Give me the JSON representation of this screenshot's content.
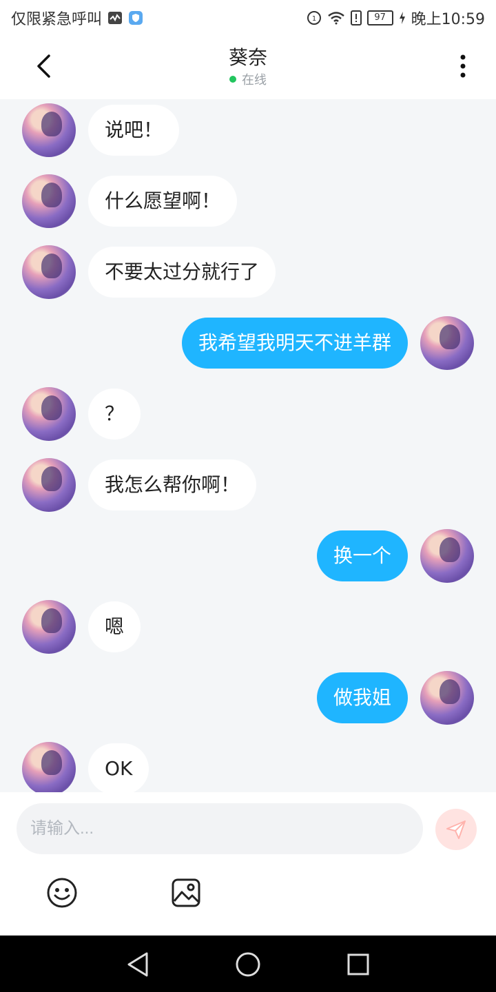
{
  "statusbar": {
    "left_text": "仅限紧急呼叫",
    "battery_level": "97",
    "time": "晚上10:59",
    "icons": [
      "activity-icon",
      "shield-icon",
      "hd-icon",
      "wifi-icon",
      "alert-icon",
      "charging-icon"
    ]
  },
  "header": {
    "title": "葵奈",
    "status": "在线",
    "status_color": "#22c55e"
  },
  "messages": [
    {
      "side": "left",
      "text": "说吧！"
    },
    {
      "side": "left",
      "text": "什么愿望啊！"
    },
    {
      "side": "left",
      "text": "不要太过分就行了"
    },
    {
      "side": "right",
      "text": "我希望我明天不进羊群"
    },
    {
      "side": "left",
      "text": "？"
    },
    {
      "side": "left",
      "text": "我怎么帮你啊！"
    },
    {
      "side": "right",
      "text": "换一个"
    },
    {
      "side": "left",
      "text": "嗯"
    },
    {
      "side": "right",
      "text": "做我姐"
    },
    {
      "side": "left",
      "text": "OK"
    }
  ],
  "composer": {
    "placeholder": "请输入..."
  },
  "colors": {
    "outgoing_bubble": "#1fb5ff",
    "incoming_bubble": "#ffffff",
    "chat_background": "#f4f6f8"
  }
}
